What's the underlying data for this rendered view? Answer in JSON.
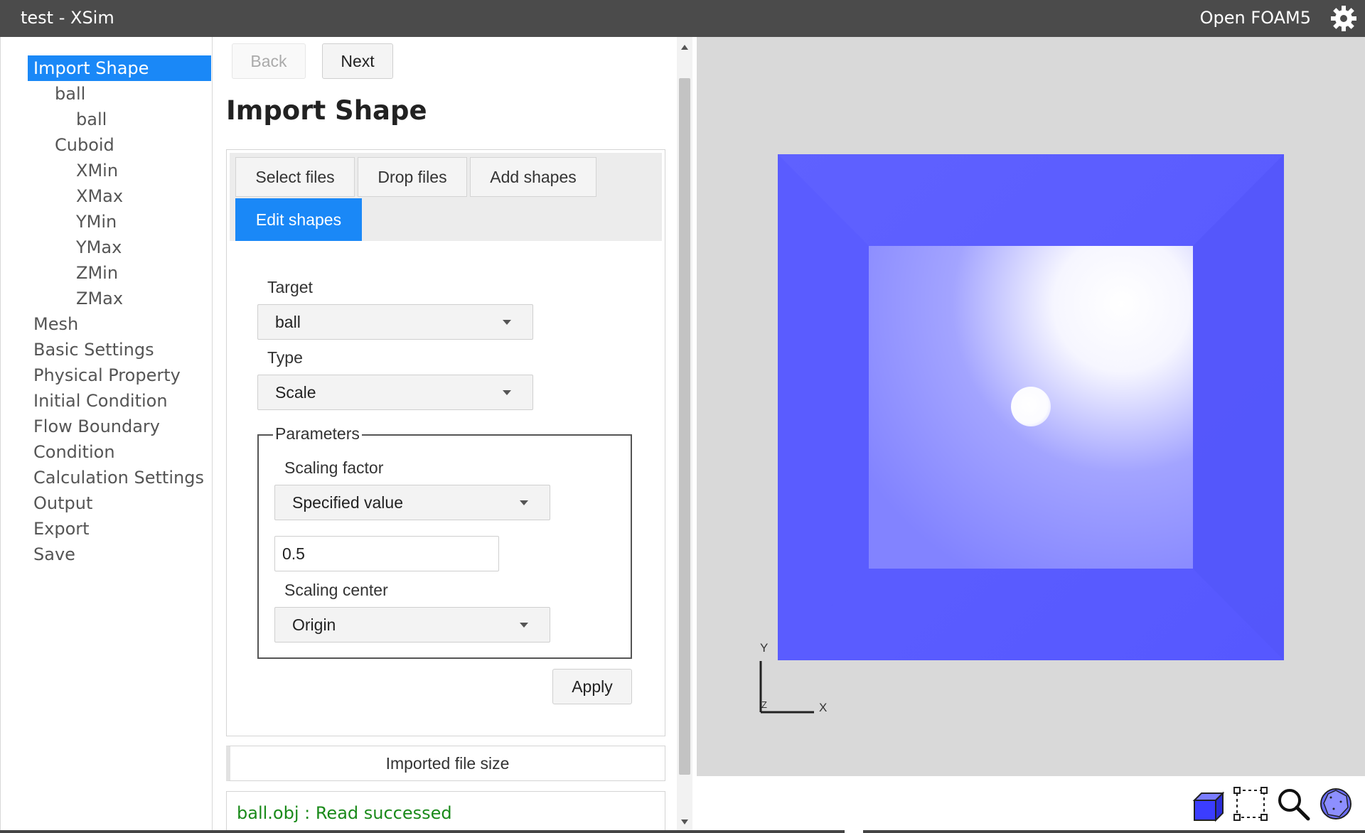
{
  "titlebar": {
    "title": "test - XSim",
    "solver": "Open FOAM5",
    "settings_icon": "gear-icon"
  },
  "nav": {
    "items": [
      {
        "label": "Import Shape",
        "level": 0,
        "active": true
      },
      {
        "label": "ball",
        "level": 1
      },
      {
        "label": "ball",
        "level": 2
      },
      {
        "label": "Cuboid",
        "level": 1
      },
      {
        "label": "XMin",
        "level": 2
      },
      {
        "label": "XMax",
        "level": 2
      },
      {
        "label": "YMin",
        "level": 2
      },
      {
        "label": "YMax",
        "level": 2
      },
      {
        "label": "ZMin",
        "level": 2
      },
      {
        "label": "ZMax",
        "level": 2
      },
      {
        "label": "Mesh",
        "level": 0
      },
      {
        "label": "Basic Settings",
        "level": 0
      },
      {
        "label": "Physical Property",
        "level": 0
      },
      {
        "label": "Initial Condition",
        "level": 0
      },
      {
        "label": "Flow Boundary",
        "level": 0
      },
      {
        "label": "Condition",
        "level": 0
      },
      {
        "label": "Calculation Settings",
        "level": 0
      },
      {
        "label": "Output",
        "level": 0
      },
      {
        "label": "Export",
        "level": 0
      },
      {
        "label": "Save",
        "level": 0
      }
    ]
  },
  "wizard": {
    "back_label": "Back",
    "next_label": "Next",
    "title": "Import Shape"
  },
  "tabs": {
    "items": [
      {
        "label": "Select files",
        "active": false
      },
      {
        "label": "Drop files",
        "active": false
      },
      {
        "label": "Add shapes",
        "active": false
      },
      {
        "label": "Edit shapes",
        "active": true
      }
    ]
  },
  "form": {
    "target_label": "Target",
    "target_value": "ball",
    "type_label": "Type",
    "type_value": "Scale",
    "parameters_legend": "Parameters",
    "scaling_factor_label": "Scaling factor",
    "scaling_factor_mode": "Specified value",
    "scaling_factor_value": "0.5",
    "scaling_center_label": "Scaling center",
    "scaling_center_value": "Origin",
    "apply_label": "Apply"
  },
  "file_info": {
    "header": "Imported file size",
    "log": "ball.obj : Read successed"
  },
  "viewport": {
    "axis_x": "X",
    "axis_y": "Y",
    "axis_z": "Z",
    "colors": {
      "cuboid": "#5a5cff",
      "background": "#d9d9d9",
      "highlight": "#ffffff"
    }
  },
  "view_tools": {
    "items": [
      "cube-view-icon",
      "fit-selection-icon",
      "zoom-icon",
      "sphere-view-icon"
    ]
  },
  "colors": {
    "accent": "#1a88f7",
    "titlebar": "#4b4b4b",
    "success_text": "#1a8a1a"
  }
}
